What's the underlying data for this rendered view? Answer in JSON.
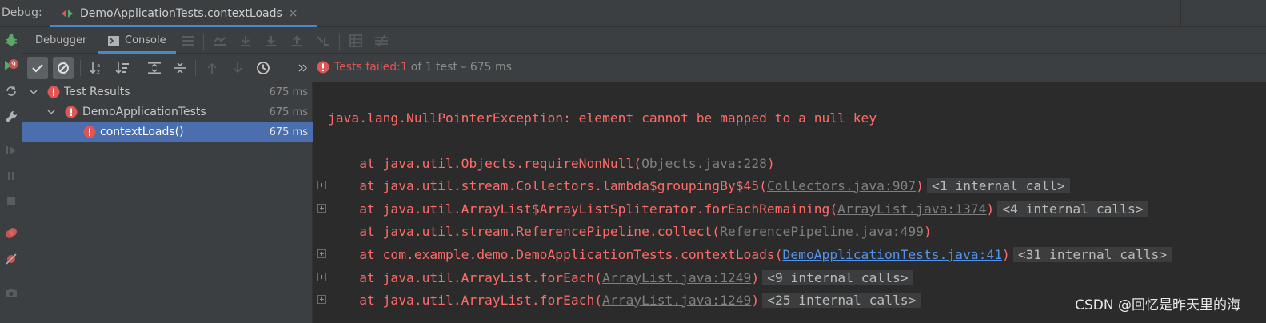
{
  "topbar": {
    "debug_label": "Debug:",
    "run_tab": {
      "label": "DemoApplicationTests.contextLoads",
      "close": "×"
    }
  },
  "tabs": {
    "debugger": "Debugger",
    "console": "Console"
  },
  "status": {
    "prefix": "Tests failed: ",
    "failed_count": "1",
    "rest": "of 1 test – 675 ms"
  },
  "tree": {
    "rows": [
      {
        "label": "Test Results",
        "time": "675 ms"
      },
      {
        "label": "DemoApplicationTests",
        "time": "675 ms"
      },
      {
        "label": "contextLoads()",
        "time": "675 ms"
      }
    ]
  },
  "console": {
    "exception": "java.lang.NullPointerException: element cannot be mapped to a null key",
    "lines": [
      {
        "at": "    at java.util.Objects.requireNonNull(",
        "link": "Objects.java:228",
        "close": ")",
        "internal": ""
      },
      {
        "at": "    at java.util.stream.Collectors.lambda$groupingBy$45(",
        "link": "Collectors.java:907",
        "close": ")",
        "internal": "<1 internal call>"
      },
      {
        "at": "    at java.util.ArrayList$ArrayListSpliterator.forEachRemaining(",
        "link": "ArrayList.java:1374",
        "close": ")",
        "internal": "<4 internal calls>"
      },
      {
        "at": "    at java.util.stream.ReferencePipeline.collect(",
        "link": "ReferencePipeline.java:499",
        "close": ")",
        "internal": ""
      },
      {
        "at": "    at com.example.demo.DemoApplicationTests.contextLoads(",
        "link": "DemoApplicationTests.java:41",
        "close": ")",
        "internal": "<31 internal calls>"
      },
      {
        "at": "    at java.util.ArrayList.forEach(",
        "link": "ArrayList.java:1249",
        "close": ")",
        "internal": "<9 internal calls>"
      },
      {
        "at": "    at java.util.ArrayList.forEach(",
        "link": "ArrayList.java:1249",
        "close": ")",
        "internal": "<25 internal calls>"
      }
    ]
  },
  "watermark": "CSDN @回忆是昨天里的海",
  "colors": {
    "error": "#ff6b68",
    "status_fail": "#e05555",
    "accent": "#4a88c7",
    "selection": "#4b6eaf",
    "user_link": "#5394ec"
  }
}
